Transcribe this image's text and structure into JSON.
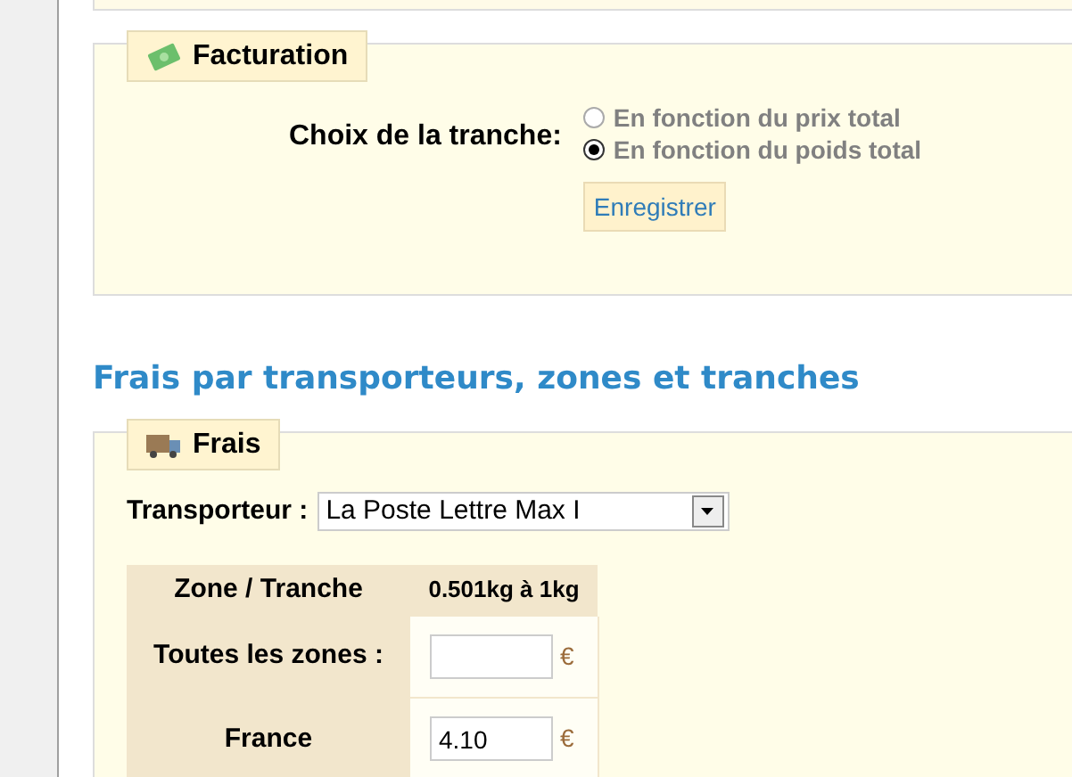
{
  "billing": {
    "legend": "Facturation",
    "label": "Choix de la tranche:",
    "options": [
      {
        "label": "En fonction du prix total",
        "selected": false
      },
      {
        "label": "En fonction du poids total",
        "selected": true
      }
    ],
    "button": "Enregistrer"
  },
  "heading": "Frais par transporteurs, zones et tranches",
  "fees": {
    "legend": "Frais",
    "carrier_label": "Transporteur :",
    "carrier": "La Poste Lettre Max I",
    "table": {
      "columns": [
        "Zone / Tranche",
        "0.501kg à 1kg"
      ],
      "rows": [
        {
          "zone": "Toutes les zones :",
          "value": "",
          "currency": "€"
        },
        {
          "zone": "France",
          "value": "4.10",
          "currency": "€"
        }
      ]
    }
  }
}
